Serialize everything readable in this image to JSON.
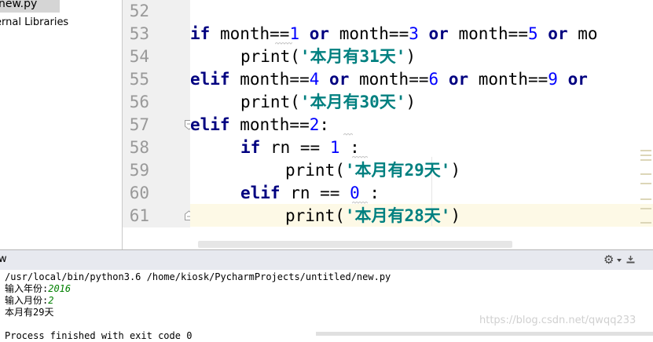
{
  "project_tree": {
    "file_name": "new.py",
    "external_libraries": "ernal Libraries"
  },
  "editor": {
    "line_numbers": [
      "52",
      "53",
      "54",
      "55",
      "56",
      "57",
      "58",
      "59",
      "60",
      "61"
    ],
    "code": {
      "l53": {
        "kw": "if",
        "a": " month==",
        "n1": "1",
        "or1": "or",
        "b": " month==",
        "n2": "3",
        "or2": "or",
        "c": " month==",
        "n3": "5",
        "or3": "or",
        "d": " mo"
      },
      "l54": {
        "fn": "print(",
        "str": "'本月有31天'",
        "end": ")"
      },
      "l55": {
        "kw": "elif",
        "a": " month==",
        "n1": "4",
        "or1": "or",
        "b": " month==",
        "n2": "6",
        "or2": "or",
        "c": " month==",
        "n3": "9",
        "or3": "or"
      },
      "l56": {
        "fn": "print(",
        "str": "'本月有30天'",
        "end": ")"
      },
      "l57": {
        "kw": "elif",
        "a": " month==",
        "n1": "2",
        "end": ":"
      },
      "l58": {
        "kw": "if",
        "a": " rn == ",
        "n1": "1",
        "end": " :"
      },
      "l59": {
        "fn": "print(",
        "str": "'本月有29天'",
        "end": ")"
      },
      "l60": {
        "kw": "elif",
        "a": " rn == ",
        "n1": "0",
        "end": " :"
      },
      "l61": {
        "fn": "print(",
        "str": "'本月有28天'",
        "end": ")"
      }
    }
  },
  "run_panel": {
    "title": "w",
    "lines": {
      "cmd": "/usr/local/bin/python3.6 /home/kiosk/PycharmProjects/untitled/new.py",
      "year_prompt": "输入年份:",
      "year_value": "2016",
      "month_prompt": "输入月份:",
      "month_value": "2",
      "result": "本月有29天",
      "finished": "Process finished with exit code 0"
    }
  },
  "watermark": "https://blog.csdn.net/qwqq233",
  "icons": {
    "gear": "gear-icon",
    "hide": "hide-panel-icon",
    "fold": "fold-marker-icon"
  },
  "colors": {
    "keyword": "#000080",
    "number": "#0000ff",
    "string": "#008080",
    "caret_row": "#fdf9e6",
    "console_input": "#008000"
  }
}
